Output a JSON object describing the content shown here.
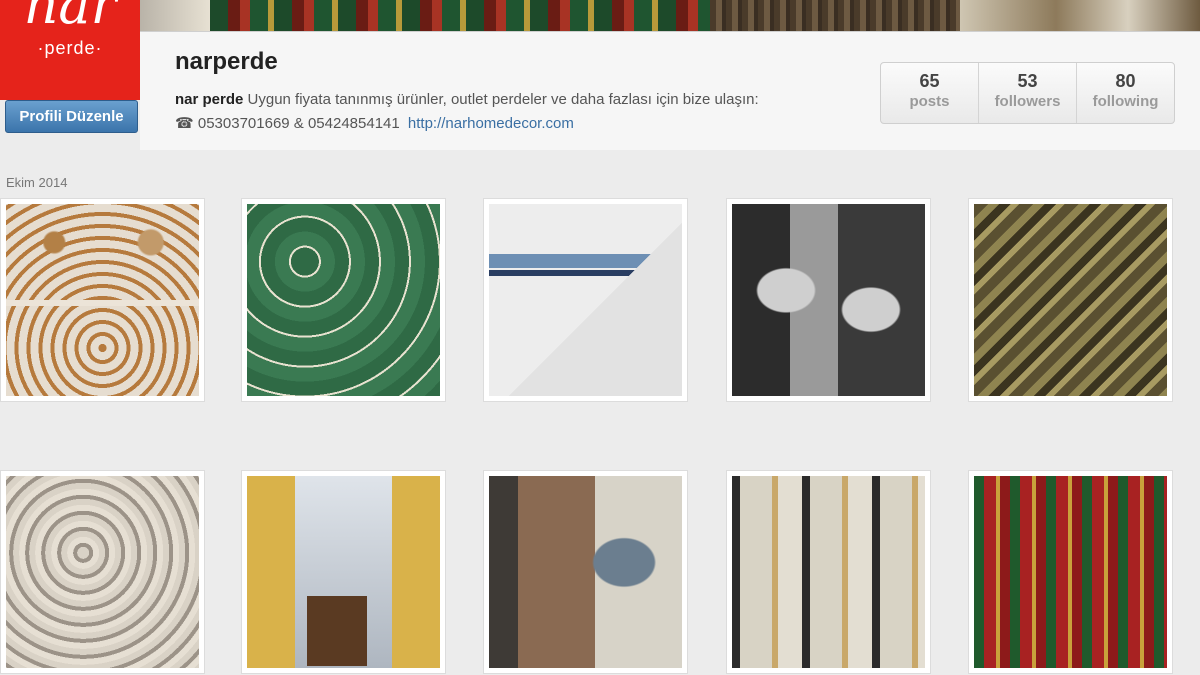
{
  "profile": {
    "logo_word": "nar",
    "logo_sub": "·perde·",
    "edit_button": "Profili Düzenle",
    "username": "narperde",
    "display_name": "nar perde",
    "bio": "Uygun fiyata tanınmış ürünler, outlet perdeler ve daha fazlası için bize ulaşın:",
    "contact_icon": "☎",
    "phones": " 05303701669 & 05424854141",
    "website": "http://narhomedecor.com"
  },
  "stats": [
    {
      "value": "65",
      "label": "posts"
    },
    {
      "value": "53",
      "label": "followers"
    },
    {
      "value": "80",
      "label": "following"
    }
  ],
  "feed": {
    "date_label": "Ekim 2014"
  },
  "colors": {
    "brand_red": "#e5231b",
    "button_blue": "#3b74ab",
    "link_blue": "#3a6fa3"
  }
}
